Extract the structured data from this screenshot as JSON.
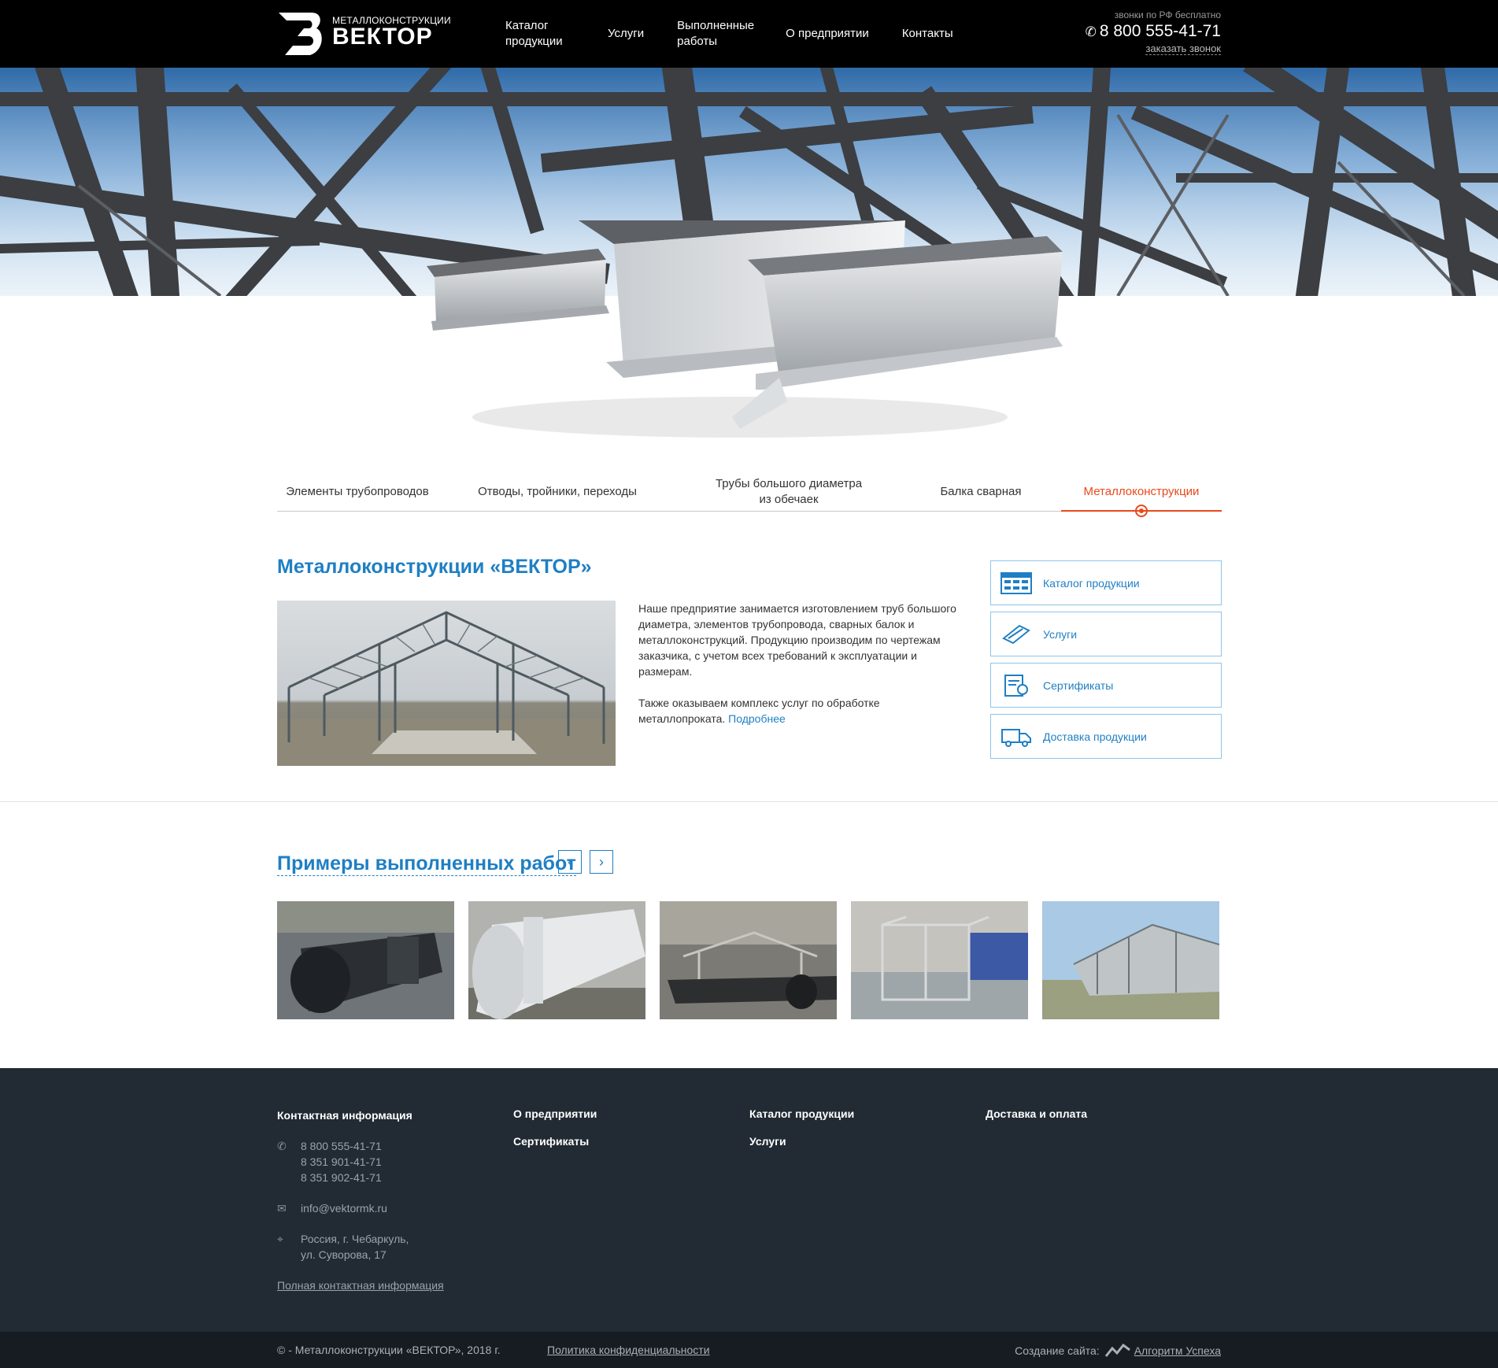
{
  "header": {
    "logo_sub": "МЕТАЛЛОКОНСТРУКЦИИ",
    "logo_main": "ВЕКТОР",
    "nav": [
      {
        "label": "Каталог продукции"
      },
      {
        "label": "Услуги"
      },
      {
        "label": "Выполненные работы"
      },
      {
        "label": "О предприятии"
      },
      {
        "label": "Контакты"
      }
    ],
    "phone_note": "звонки по РФ бесплатно",
    "phone": "8 800 555-41-71",
    "callback": "заказать звонок"
  },
  "tabs": [
    {
      "label": "Элементы трубопроводов"
    },
    {
      "label": "Отводы, тройники, переходы"
    },
    {
      "label": "Трубы большого диаметра из обечаек"
    },
    {
      "label": "Балка сварная"
    },
    {
      "label": "Металлоконструкции",
      "active": true
    }
  ],
  "about": {
    "title": "Металлоконструкции «ВЕКТОР»",
    "p1": "Наше предприятие занимается изготовлением труб большого диаметра, элементов трубопровода, сварных балок и металлоконструкций. Продукцию производим по чертежам заказчика, с учетом всех требований к эксплуатации и размерам.",
    "p2": "Также оказываем комплекс услуг по обработке металлопроката.",
    "more": "Подробнее"
  },
  "side_links": [
    {
      "label": "Каталог продукции",
      "icon": "catalog-icon"
    },
    {
      "label": "Услуги",
      "icon": "tools-icon"
    },
    {
      "label": "Сертификаты",
      "icon": "certificate-icon"
    },
    {
      "label": "Доставка продукции",
      "icon": "truck-icon"
    }
  ],
  "examples": {
    "title": "Примеры выполненных работ",
    "prev": "‹",
    "next": "›"
  },
  "footer": {
    "contacts_head": "Контактная информация",
    "phones": [
      "8 800 555-41-71",
      "8 351 901-41-71",
      "8 351 902-41-71"
    ],
    "email": "info@vektormk.ru",
    "address1": "Россия, г. Чебаркуль,",
    "address2": "ул. Суворова, 17",
    "full_contacts": "Полная контактная информация",
    "col2": [
      "О предприятии",
      "Сертификаты"
    ],
    "col3": [
      "Каталог продукции",
      "Услуги"
    ],
    "col4": [
      "Доставка и оплата"
    ]
  },
  "bottom": {
    "copyright": "© - Металлоконструкции «ВЕКТОР», 2018 г.",
    "policy": "Политика конфиденциальности",
    "dev_label": "Создание сайта:",
    "dev_link": "Алгоритм Успеха"
  },
  "colors": {
    "accent": "#1f7fc4",
    "active_tab": "#e8491d",
    "footer_bg": "#222b34"
  }
}
